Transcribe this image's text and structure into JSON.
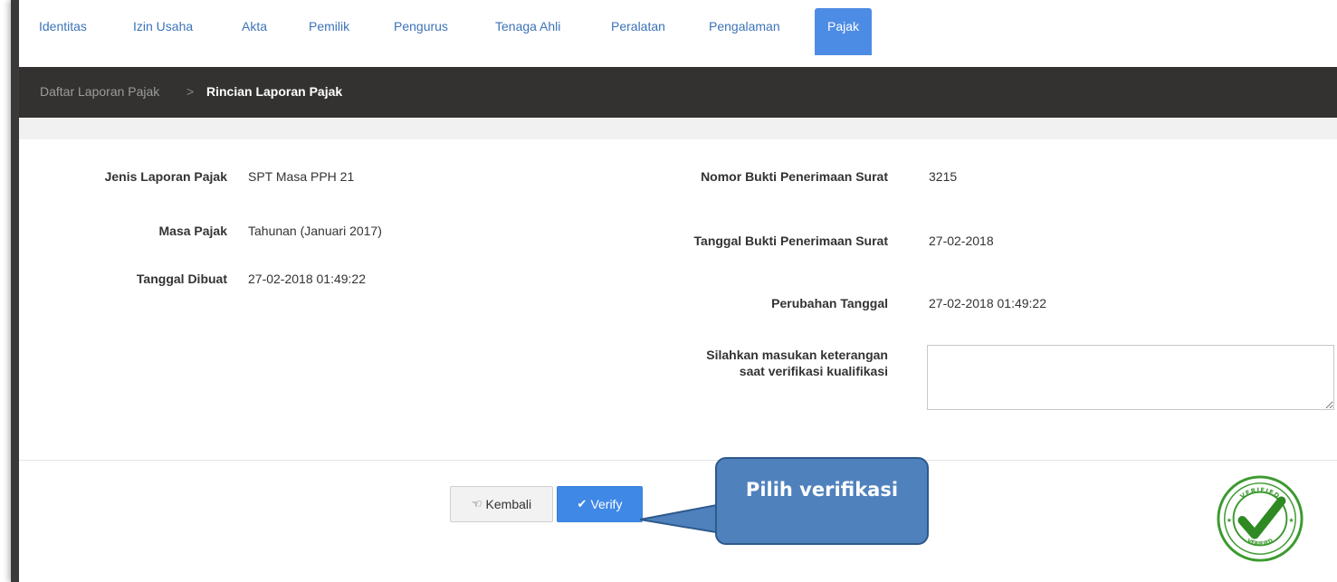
{
  "tabs": [
    {
      "label": "Identitas"
    },
    {
      "label": "Izin Usaha"
    },
    {
      "label": "Akta"
    },
    {
      "label": "Pemilik"
    },
    {
      "label": "Pengurus"
    },
    {
      "label": "Tenaga Ahli"
    },
    {
      "label": "Peralatan"
    },
    {
      "label": "Pengalaman"
    },
    {
      "label": "Pajak",
      "active": true
    }
  ],
  "breadcrumb": {
    "parent": "Daftar Laporan Pajak",
    "separator": ">",
    "current": "Rincian Laporan Pajak"
  },
  "details_left": [
    {
      "label": "Jenis Laporan Pajak",
      "value": "SPT Masa PPH 21"
    },
    {
      "label": "Masa Pajak",
      "value": "Tahunan (Januari 2017)"
    },
    {
      "label": "Tanggal Dibuat",
      "value": "27-02-2018 01:49:22"
    }
  ],
  "details_right": [
    {
      "label": "Nomor Bukti Penerimaan Surat",
      "value": "3215"
    },
    {
      "label": "Tanggal Bukti Penerimaan Surat",
      "value": "27-02-2018"
    },
    {
      "label": "Perubahan Tanggal",
      "value": "27-02-2018 01:49:22"
    },
    {
      "label": "Silahkan masukan keterangan saat verifikasi kualifikasi",
      "value": ""
    }
  ],
  "buttons": {
    "back_label": "Kembali",
    "verify_label": "Verify"
  },
  "callout": {
    "text": "Pilih verifikasi"
  },
  "stamp": {
    "top_text": "VERIFIED",
    "bottom_text": "VERIFIED"
  },
  "colors": {
    "accent": "#4d8ce4",
    "tab_text": "#3c73b8",
    "crumb_bar": "#333230",
    "verify_button": "#3f88e6",
    "callout": "#4f81bd",
    "stamp_green": "#3c9a2f"
  },
  "icons": {
    "back": "hand-pointing-left-icon",
    "verify": "checkmark-icon"
  }
}
